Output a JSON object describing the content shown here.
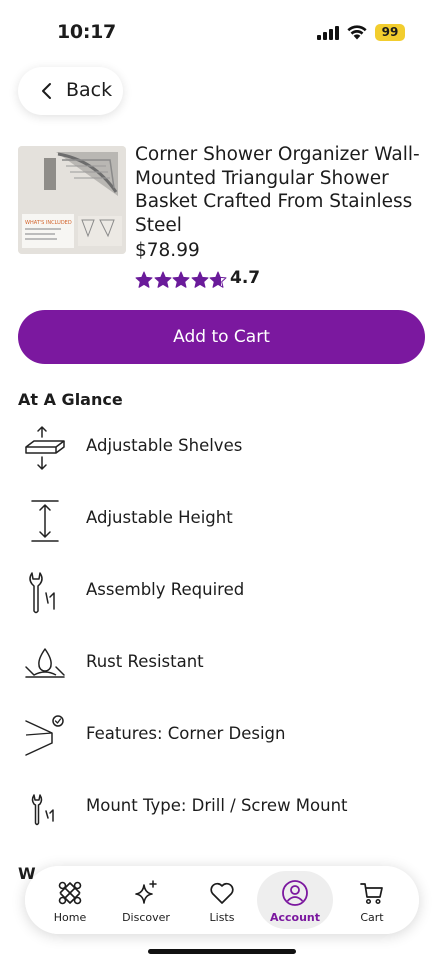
{
  "status_bar": {
    "time": "10:17",
    "battery": "99"
  },
  "nav": {
    "back_label": "Back"
  },
  "product": {
    "title": "Corner Shower Organizer Wall-Mounted Triangular Shower Basket Crafted From Stainless Steel",
    "price": "$78.99",
    "rating": "4.7",
    "rating_value": 4.7,
    "stars_max": 5,
    "thumbnail_text": "WHAT'S INCLUDED"
  },
  "actions": {
    "add_to_cart": "Add to Cart"
  },
  "at_a_glance": {
    "title": "At A Glance",
    "features": [
      {
        "label": "Adjustable Shelves",
        "icon": "adjustable-shelves-icon"
      },
      {
        "label": "Adjustable Height",
        "icon": "adjustable-height-icon"
      },
      {
        "label": "Assembly Required",
        "icon": "assembly-tools-icon"
      },
      {
        "label": "Rust Resistant",
        "icon": "rust-resistant-icon"
      },
      {
        "label": "Features: Corner Design",
        "icon": "corner-design-icon"
      },
      {
        "label": "Mount Type: Drill / Screw Mount",
        "icon": "mount-tools-icon"
      }
    ]
  },
  "partial_heading": "W",
  "tab_bar": {
    "tabs": [
      {
        "label": "Home",
        "icon": "home-icon",
        "active": false
      },
      {
        "label": "Discover",
        "icon": "sparkle-icon",
        "active": false
      },
      {
        "label": "Lists",
        "icon": "heart-icon",
        "active": false
      },
      {
        "label": "Account",
        "icon": "account-icon",
        "active": true
      },
      {
        "label": "Cart",
        "icon": "cart-icon",
        "active": false
      }
    ]
  },
  "colors": {
    "accent": "#7b189f",
    "star": "#6a1b9a",
    "battery": "#f2cd2e"
  }
}
